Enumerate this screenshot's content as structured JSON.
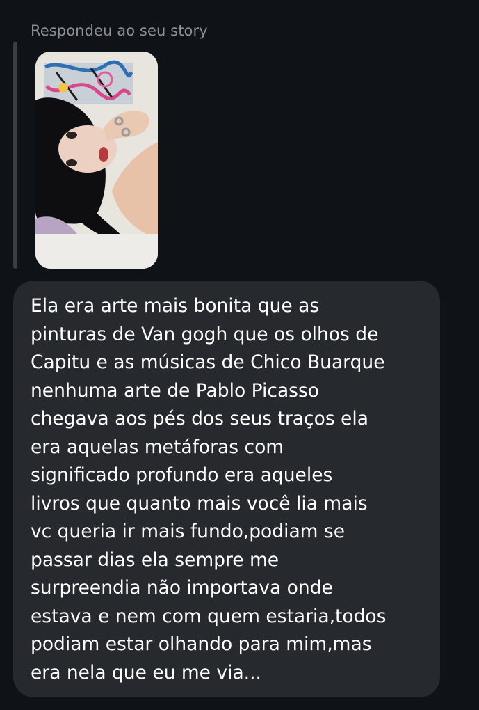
{
  "reply_header": {
    "label": "Respondeu ao seu story"
  },
  "story_preview": {
    "alt": "story photo"
  },
  "message": {
    "lines": [
      "Ela era arte mais bonita que as",
      "pinturas de Van gogh que os olhos de",
      "Capitu e as músicas de Chico Buarque",
      "nenhuma arte de Pablo Picasso",
      "chegava aos pés dos seus traços ela",
      "era aquelas metáforas com",
      "significado profundo era aqueles",
      "livros que quanto mais você lia mais",
      "vc queria ir mais fundo,podiam se",
      "passar dias ela sempre me",
      "surpreendia não importava onde",
      "estava e nem com quem estaria,todos",
      "podiam estar olhando para mim,mas",
      "era nela que eu me via..."
    ]
  },
  "colors": {
    "background": "#0f1318",
    "bubble": "#262a2f",
    "label": "#8e9096",
    "text": "#ffffff",
    "quote_bar": "#3b3e43"
  }
}
